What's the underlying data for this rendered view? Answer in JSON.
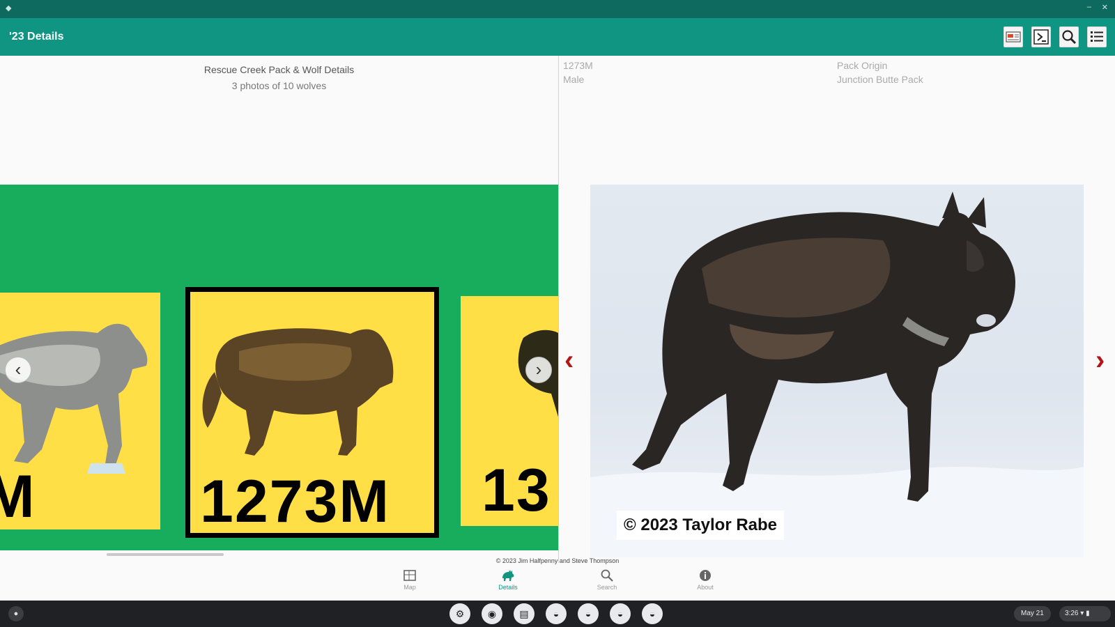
{
  "system_bar": {
    "back_glyph": "◆",
    "minimize_glyph": "–",
    "close_glyph": "✕"
  },
  "app_bar": {
    "title": "'23 Details",
    "actions": [
      {
        "icon": "map-card-icon"
      },
      {
        "icon": "terminal-icon"
      },
      {
        "icon": "search-icon"
      },
      {
        "icon": "list-icon"
      }
    ]
  },
  "left_pane": {
    "title": "Rescue Creek Pack & Wolf Details",
    "subtitle": "3 photos of 10 wolves",
    "cards": [
      {
        "label": "M",
        "color": "#ffdf45"
      },
      {
        "label": "1273M",
        "color": "#ffdf45"
      },
      {
        "label": "13",
        "color": "#ffdf45"
      }
    ],
    "prev_glyph": "‹",
    "next_glyph": "›",
    "background": "#17ad5c"
  },
  "right_pane": {
    "wolf_id": "1273M",
    "sex": "Male",
    "origin_label": "Pack Origin",
    "origin_value": "Junction Butte Pack",
    "photo_credit": "© 2023 Taylor Rabe",
    "prev_glyph": "‹",
    "next_glyph": "›",
    "arrow_color": "#b01818"
  },
  "footer": {
    "copyright": "© 2023 Jim Halfpenny and Steve Thompson"
  },
  "bottom_nav": {
    "items": [
      {
        "label": "Map",
        "icon": "map-icon"
      },
      {
        "label": "Details",
        "icon": "wolf-icon",
        "active": true
      },
      {
        "label": "Search",
        "icon": "search-icon"
      },
      {
        "label": "About",
        "icon": "info-icon"
      }
    ]
  },
  "shelf": {
    "launcher_glyph": "●",
    "apps": [
      {
        "icon": "settings-icon",
        "glyph": "⚙"
      },
      {
        "icon": "chrome-icon",
        "glyph": "◉"
      },
      {
        "icon": "files-icon",
        "glyph": "▤"
      },
      {
        "icon": "wolf-app-icon-1",
        "glyph": "◒"
      },
      {
        "icon": "wolf-app-icon-2",
        "glyph": "◒"
      },
      {
        "icon": "wolf-app-icon-3",
        "glyph": "◒"
      },
      {
        "icon": "wolf-app-icon-4",
        "glyph": "◒"
      }
    ],
    "date": "May 21",
    "time": "3:26",
    "wifi_glyph": "▾",
    "battery_glyph": "▮"
  },
  "colors": {
    "app_bar": "#0f9582",
    "system_bar": "#0e6a5e",
    "accent": "#0f9582"
  }
}
